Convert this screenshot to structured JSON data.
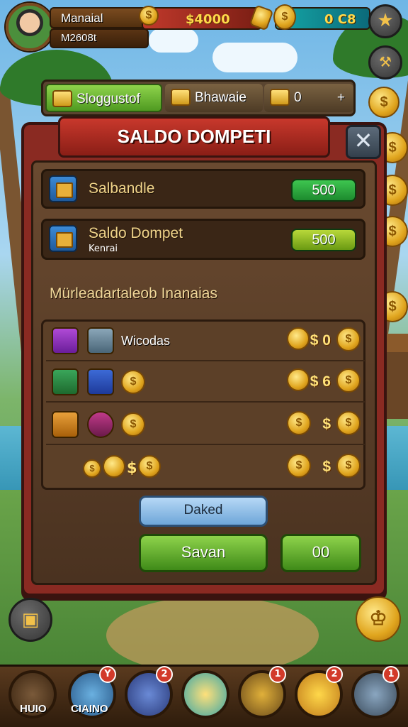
{
  "hud": {
    "player_name": "Manaial",
    "player_id": "M2608t",
    "coins": "$4000",
    "gems": "0 C8"
  },
  "tabs": [
    {
      "label": "Sloggustof"
    },
    {
      "label": "Bhawaie"
    },
    {
      "label": "0",
      "extra": "+"
    }
  ],
  "dialog": {
    "title": "SALDO DOMPETI",
    "close_label": "✕",
    "rows": [
      {
        "label": "Salbandle",
        "value": "500"
      },
      {
        "label": "Saldo Dompet",
        "sublabel": "Kenrai",
        "value": "500"
      }
    ],
    "section_label": "Mürleadartaleob Inanaias",
    "items": [
      {
        "text": "Wicodas",
        "value": "$ 0"
      },
      {
        "text": "",
        "value": "$ 6"
      },
      {
        "text": "",
        "value": "$"
      },
      {
        "text": "$",
        "value": "$"
      }
    ],
    "buttons": {
      "secondary": "Daked",
      "primary": "Savan",
      "amount": "00"
    }
  },
  "nav": {
    "items": [
      {
        "label": "HUIO",
        "badge": ""
      },
      {
        "label": "CIAINO",
        "badge": "Y"
      },
      {
        "label": "",
        "badge": "2"
      },
      {
        "label": "",
        "badge": ""
      },
      {
        "label": "",
        "badge": "1"
      },
      {
        "label": "",
        "badge": "2"
      },
      {
        "label": "",
        "badge": "1"
      }
    ]
  },
  "colors": {
    "panel_red": "#8a2a22",
    "panel_brown": "#4a3220",
    "button_green": "#4f9a21",
    "button_blue": "#6ea6d8",
    "gold": "#e0a51e"
  }
}
